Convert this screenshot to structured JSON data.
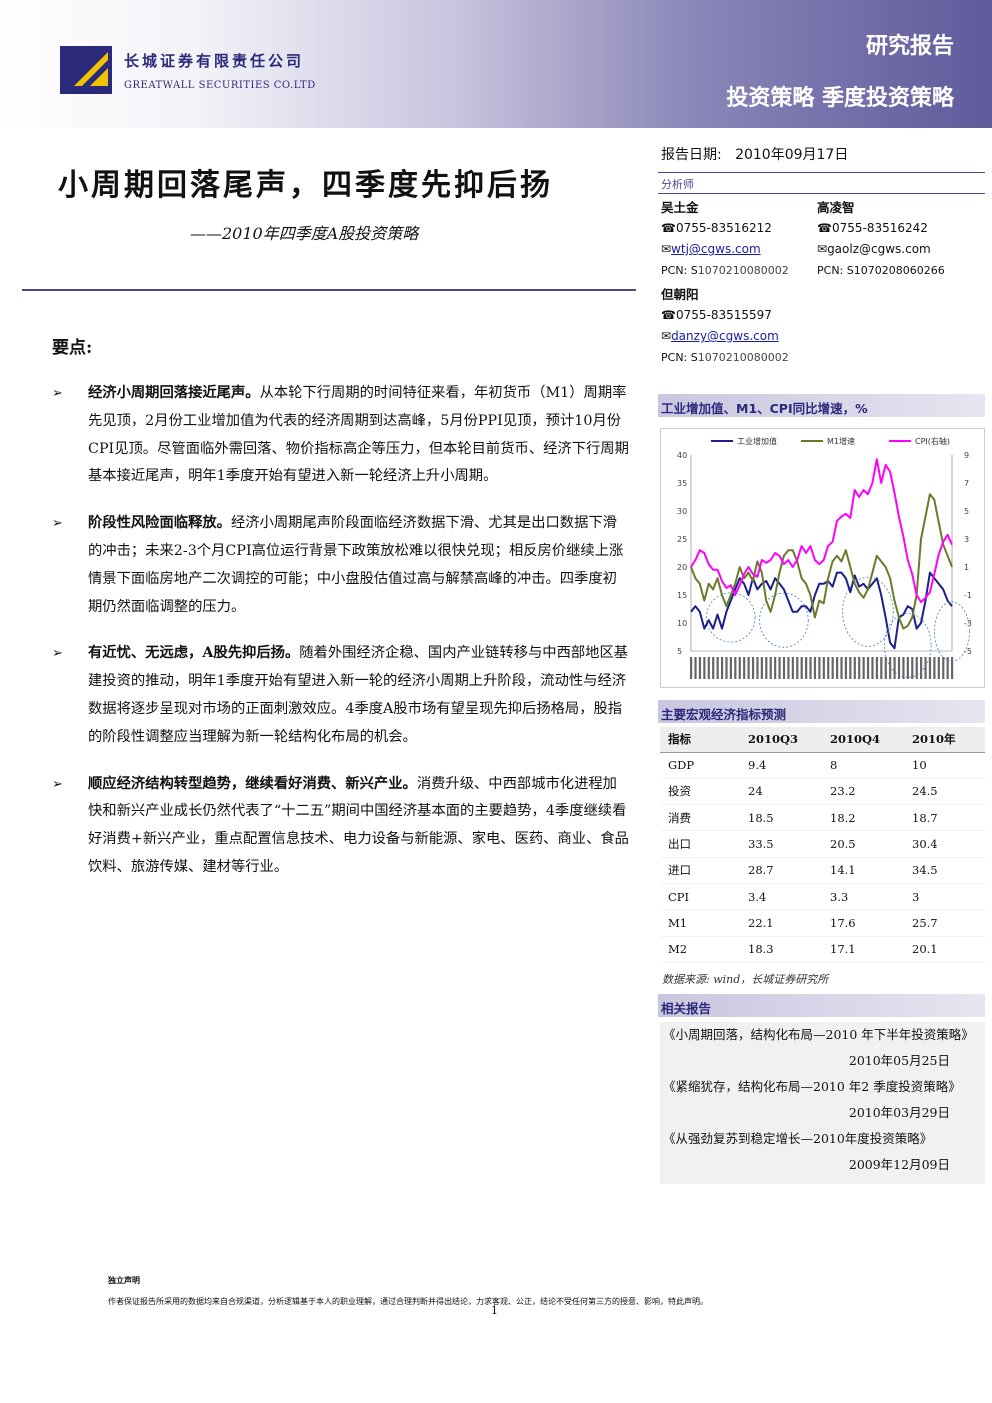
{
  "header": {
    "company_cn": "长城证券有限责任公司",
    "company_en": "GREATWALL SECURITIES CO.LTD",
    "report_type": "研究报告",
    "report_category": "投资策略 季度投资策略",
    "colors": {
      "brand_purple": "#4b4690",
      "logo_navy": "#2b2a7a",
      "logo_gold": "#f2c200"
    }
  },
  "title": {
    "main": "小周期回落尾声，四季度先抑后扬",
    "sub": "——2010年四季度A股投资策略"
  },
  "key_points": {
    "heading": "要点:",
    "bullet": "➢",
    "items": [
      {
        "lead": "经济小周期回落接近尾声。",
        "text": "从本轮下行周期的时间特征来看，年初货币（M1）周期率先见顶，2月份工业增加值为代表的经济周期到达高峰，5月份PPI见顶，预计10月份CPI见顶。尽管面临外需回落、物价指标高企等压力，但本轮目前货币、经济下行周期基本接近尾声，明年1季度开始有望进入新一轮经济上升小周期。"
      },
      {
        "lead": "阶段性风险面临释放。",
        "text": "经济小周期尾声阶段面临经济数据下滑、尤其是出口数据下滑的冲击；未来2-3个月CPI高位运行背景下政策放松难以很快兑现；相反房价继续上涨情景下面临房地产二次调控的可能；中小盘股估值过高与解禁高峰的冲击。四季度初期仍然面临调整的压力。"
      },
      {
        "lead": "有近忧、无远虑，A股先抑后扬。",
        "text": "随着外围经济企稳、国内产业链转移与中西部地区基建投资的推动，明年1季度开始有望进入新一轮的经济小周期上升阶段，流动性与经济数据将逐步呈现对市场的正面刺激效应。4季度A股市场有望呈现先抑后扬格局，股指的阶段性调整应当理解为新一轮结构化布局的机会。"
      },
      {
        "lead": "顺应经济结构转型趋势，继续看好消费、新兴产业。",
        "text": "消费升级、中西部城市化进程加快和新兴产业成长仍然代表了“十二五”期间中国经济基本面的主要趋势，4季度继续看好消费+新兴产业，重点配置信息技术、电力设备与新能源、家电、医药、商业、食品饮料、旅游传媒、建材等行业。"
      }
    ]
  },
  "report_info": {
    "date_label": "报告日期:",
    "date_value": "2010年09月17日",
    "analyst_label": "分析师",
    "analysts": [
      {
        "name": "吴土金",
        "phone": "☎0755-83516212",
        "email": "wtj@cgws.com",
        "pcn_label": "PCN: S",
        "pcn_num": "1070210080002"
      },
      {
        "name": "高凌智",
        "phone": "☎0755-83516242",
        "email": "gaolz@cgws.com",
        "pcn_label": "PCN: S",
        "pcn_num": "1070208060266"
      },
      {
        "name": "但朝阳",
        "phone": "☎0755-83515597",
        "email": "danzy@cgws.com",
        "pcn_label": "PCN: S",
        "pcn_num": "1070210080002"
      }
    ]
  },
  "chart_section": {
    "title": "工业增加值、M1、CPI同比增速，%"
  },
  "chart_data": {
    "type": "line",
    "legend": [
      "工业增加值",
      "M1增速",
      "CPI(右轴)"
    ],
    "legend_placement": "top",
    "ylim_left": [
      5,
      40
    ],
    "yticks_left": [
      "40",
      "35",
      "30",
      "25",
      "20",
      "15",
      "10",
      "5"
    ],
    "ylim_right": [
      -5,
      9
    ],
    "yticks_right": [
      "9",
      "7",
      "5",
      "3",
      "1",
      "-1",
      "-3",
      "-5"
    ],
    "series": [
      {
        "name": "工业增加值",
        "color": "#1c1f8a",
        "values": [
          12,
          13,
          12,
          9,
          10.5,
          9,
          11.5,
          9,
          12,
          14,
          16,
          18,
          17,
          15,
          18,
          16,
          17,
          17.5,
          16,
          18,
          17,
          16,
          14,
          12,
          12,
          13,
          13,
          12,
          15,
          17,
          17,
          17.5,
          16.5,
          19,
          19,
          18,
          15.5,
          18.5,
          16.5,
          17,
          16,
          17,
          18,
          15,
          11,
          6.5,
          5.5,
          11,
          11.5,
          13,
          12.5,
          9,
          10,
          14,
          19,
          18,
          17,
          16,
          14,
          13
        ]
      },
      {
        "name": "M1增速",
        "color": "#6b7a2a",
        "values": [
          20,
          18,
          17,
          14,
          17,
          16,
          18,
          15,
          13,
          15,
          17,
          20,
          18,
          19,
          17.5,
          21,
          19,
          14,
          12,
          15,
          19,
          22,
          23,
          23,
          21,
          18,
          17,
          15,
          11,
          14,
          13.5,
          18,
          21,
          22,
          21,
          23,
          20,
          17,
          15.5,
          14.5,
          16,
          19,
          22,
          21,
          20,
          18,
          14,
          11,
          9,
          9.5,
          11,
          15,
          25,
          29,
          33,
          32,
          28,
          24,
          22,
          20
        ]
      },
      {
        "name": "CPI(右轴)",
        "color": "#ff00ff",
        "values": [
          1.0,
          1.5,
          2.2,
          2.0,
          1.2,
          0.8,
          0.8,
          0.0,
          -0.5,
          -0.3,
          -1.0,
          -0.3,
          0.5,
          1.0,
          0.5,
          0.3,
          1.5,
          1.3,
          1.5,
          2.0,
          1.8,
          1.2,
          1.5,
          1.0,
          1.5,
          2.5,
          2.0,
          2.5,
          1.5,
          1.2,
          1.5,
          2.5,
          2.8,
          4.3,
          4.6,
          4.8,
          4.5,
          6.5,
          6.0,
          6.5,
          6.2,
          7.0,
          8.7,
          7.0,
          8.3,
          7.8,
          6.3,
          4.6,
          3.2,
          1.5,
          0.5,
          -1.0,
          -1.5,
          -1.2,
          -0.8,
          0.5,
          1.9,
          2.8,
          3.3,
          2.6
        ]
      }
    ]
  },
  "macro_table": {
    "title": "主要宏观经济指标预测",
    "headers": [
      "指标",
      "2010Q3",
      "2010Q4",
      "2010年"
    ],
    "rows": [
      [
        "GDP",
        "9.4",
        "8",
        "10"
      ],
      [
        "投资",
        "24",
        "23.2",
        "24.5"
      ],
      [
        "消费",
        "18.5",
        "18.2",
        "18.7"
      ],
      [
        "出口",
        "33.5",
        "20.5",
        "30.4"
      ],
      [
        "进口",
        "28.7",
        "14.1",
        "34.5"
      ],
      [
        "CPI",
        "3.4",
        "3.3",
        "3"
      ],
      [
        "M1",
        "22.1",
        "17.6",
        "25.7"
      ],
      [
        "M2",
        "18.3",
        "17.1",
        "20.1"
      ]
    ],
    "source": "数据来源: wind，长城证券研究所"
  },
  "related": {
    "title": "相关报告",
    "items": [
      {
        "title": "《小周期回落，结构化布局—2010 年下半年投资策略》",
        "date": "2010年05月25日"
      },
      {
        "title": "《紧缩犹存，结构化布局—2010 年2 季度投资策略》",
        "date": "2010年03月29日"
      },
      {
        "title": "《从强劲复苏到稳定增长—2010年度投资策略》",
        "date": "2009年12月09日"
      }
    ]
  },
  "footer": {
    "heading": "独立声明",
    "text": "作者保证报告所采用的数据均来自合规渠道，分析逻辑基于本人的职业理解，通过合理判断并得出结论，力求客观、公正，结论不受任何第三方的授意、影响，特此声明。",
    "page": "1"
  }
}
